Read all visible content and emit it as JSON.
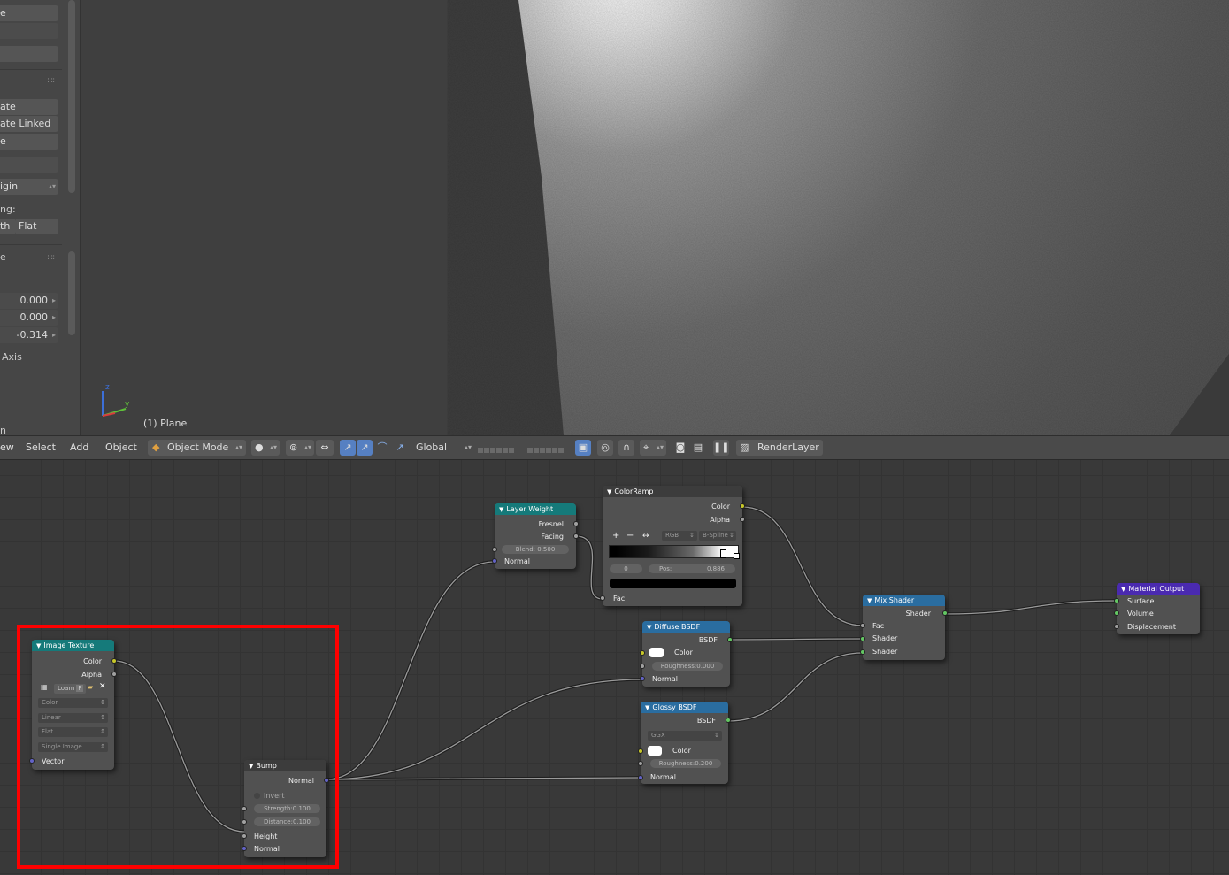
{
  "left_panel": {
    "btn_1": "e",
    "header_dots": "::::",
    "btn_duplicate": "ate",
    "btn_duplicate_linked": "ate Linked",
    "btn_delete": "e",
    "origin_label": "igin",
    "shading_label": "ng:",
    "smooth_label": "th",
    "flat_label": "Flat",
    "section_title": "e",
    "value_x": "0.000",
    "value_y": "0.000",
    "value_z": "-0.314",
    "axis_label": "Axis",
    "bottom_text": "n"
  },
  "viewport": {
    "object_label": "(1) Plane",
    "axis_z": "z",
    "axis_y": "y",
    "colors": {
      "wall_dark": "#3f3f3f",
      "wall_light": "#ffffff"
    }
  },
  "header": {
    "menu_view": "ew",
    "menu_select": "Select",
    "menu_add": "Add",
    "menu_object": "Object",
    "mode": "Object Mode",
    "orientation": "Global",
    "render_layer": "RenderLayer"
  },
  "nodes": {
    "image_texture": {
      "title": "Image Texture",
      "out_color": "Color",
      "out_alpha": "Alpha",
      "image_name": "Loam",
      "fake_user": "F",
      "color_space": "Color",
      "interpolation": "Linear",
      "projection": "Flat",
      "extension": "Single Image",
      "in_vector": "Vector"
    },
    "bump": {
      "title": "Bump",
      "out_normal": "Normal",
      "invert": "Invert",
      "strength_label": "Strength:",
      "strength": "0.100",
      "distance_label": "Distance:",
      "distance": "0.100",
      "in_height": "Height",
      "in_normal": "Normal"
    },
    "layer_weight": {
      "title": "Layer Weight",
      "out_fresnel": "Fresnel",
      "out_facing": "Facing",
      "blend_label": "Blend:",
      "blend": "0.500",
      "in_normal": "Normal"
    },
    "color_ramp": {
      "title": "ColorRamp",
      "out_color": "Color",
      "out_alpha": "Alpha",
      "plus": "+",
      "minus": "−",
      "flip": "↔",
      "color_mode": "RGB",
      "interpolation": "B-Spline",
      "stop_index": "0",
      "pos_label": "Pos:",
      "pos": "0.886",
      "in_fac": "Fac"
    },
    "diffuse": {
      "title": "Diffuse BSDF",
      "out_bsdf": "BSDF",
      "in_color": "Color",
      "roughness_label": "Roughness:",
      "roughness": "0.000",
      "in_normal": "Normal"
    },
    "glossy": {
      "title": "Glossy BSDF",
      "out_bsdf": "BSDF",
      "distribution": "GGX",
      "in_color": "Color",
      "roughness_label": "Roughness:",
      "roughness": "0.200",
      "in_normal": "Normal"
    },
    "mix_shader": {
      "title": "Mix Shader",
      "out_shader": "Shader",
      "in_fac": "Fac",
      "in_shader_1": "Shader",
      "in_shader_2": "Shader"
    },
    "material_output": {
      "title": "Material Output",
      "in_surface": "Surface",
      "in_volume": "Volume",
      "in_displacement": "Displacement"
    }
  },
  "colors": {
    "highlight": "#ff0000",
    "socket_color": "#c7c729",
    "socket_float": "#a1a1a1",
    "socket_vector": "#6363c7",
    "socket_shader": "#63c763"
  }
}
